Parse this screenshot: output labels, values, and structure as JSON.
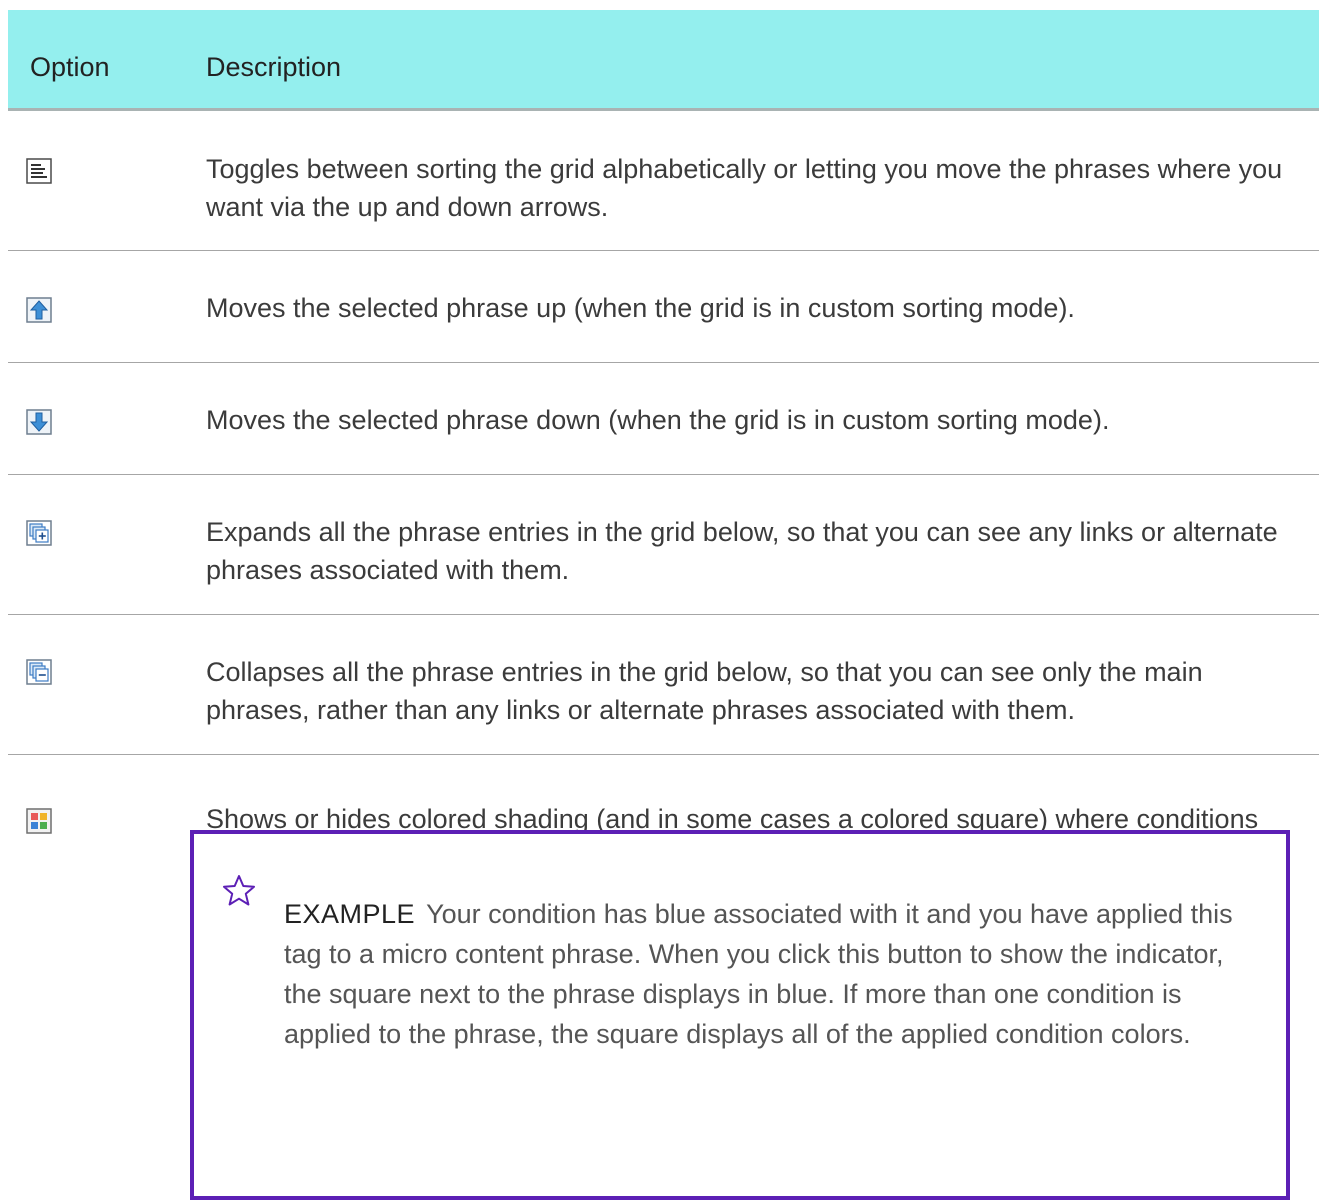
{
  "table": {
    "headers": {
      "option": "Option",
      "description": "Description"
    },
    "rows": [
      {
        "icon": "sort-lines-icon",
        "description": "Toggles between sorting the grid alphabetically or letting you move the phrases where you want via the up and down arrows."
      },
      {
        "icon": "move-up-arrow-icon",
        "description": "Moves the selected phrase up (when the grid is in custom sorting mode)."
      },
      {
        "icon": "move-down-arrow-icon",
        "description": "Moves the selected phrase down (when the grid is in custom sorting mode)."
      },
      {
        "icon": "expand-all-icon",
        "description": "Expands all the phrase entries in the grid below, so that you can see any links or alternate phrases associated with them."
      },
      {
        "icon": "collapse-all-icon",
        "description": "Collapses all the phrase entries in the grid below, so that you can see only the main phrases, rather than any links or alternate phrases associated with them."
      },
      {
        "icon": "condition-indicator-icon",
        "description": "Shows or hides colored shading (and in some cases a colored square) where conditions have been applied."
      }
    ]
  },
  "example": {
    "icon": "star-outline-icon",
    "label": "EXAMPLE",
    "text": "Your condition has blue associated with it and you have applied this tag to a micro content phrase. When you click this button to show the indicator, the square next to the phrase displays in blue. If more than one condition is applied to the phrase, the square displays all of the applied condition colors."
  },
  "colors": {
    "header_background": "#94efee",
    "example_border": "#5c1fb5",
    "row_divider": "#a6a6a6"
  }
}
